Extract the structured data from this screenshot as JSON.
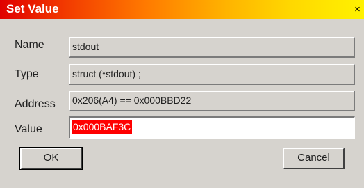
{
  "window": {
    "title": "Set Value",
    "close_glyph": "×"
  },
  "fields": {
    "name_label": "Name",
    "name_value": "stdout",
    "type_label": "Type",
    "type_value": "struct (*stdout) ;",
    "address_label": "Address",
    "address_value": "0x206(A4) == 0x000BBD22",
    "value_label": "Value",
    "value_input": "0x000BAF3C"
  },
  "buttons": {
    "ok_label": "OK",
    "cancel_label": "Cancel"
  },
  "colors": {
    "title_gradient_start": "#e00000",
    "title_gradient_end": "#fff200",
    "selection": "#ff0000",
    "dialog_bg": "#d6d3ce"
  }
}
